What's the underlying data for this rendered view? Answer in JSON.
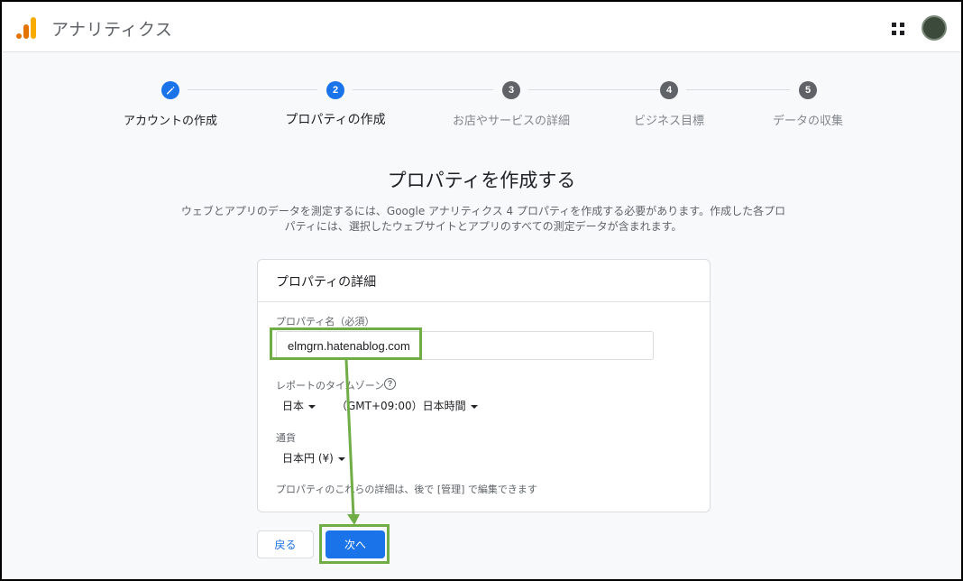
{
  "header": {
    "app_title": "アナリティクス",
    "logo_icon": "analytics-logo-icon",
    "apps_icon": "apps-grid-icon",
    "accent_color": "#f9ab00"
  },
  "stepper": {
    "steps": [
      {
        "label": "アカウントの作成",
        "marker": "",
        "state": "done",
        "icon": "pencil-icon"
      },
      {
        "label": "プロパティの作成",
        "marker": "2",
        "state": "current"
      },
      {
        "label": "お店やサービスの詳細",
        "marker": "3",
        "state": "future"
      },
      {
        "label": "ビジネス目標",
        "marker": "4",
        "state": "future"
      },
      {
        "label": "データの収集",
        "marker": "5",
        "state": "future"
      }
    ],
    "active_color": "#1a73e8",
    "future_color": "#5f6368"
  },
  "main": {
    "title": "プロパティを作成する",
    "description": "ウェブとアプリのデータを測定するには、Google アナリティクス 4 プロパティを作成する必要があります。作成した各プロパティには、選択したウェブサイトとアプリのすべての測定データが含まれます。"
  },
  "card": {
    "title": "プロパティの詳細",
    "property_name_label": "プロパティ名（必須）",
    "property_name_value": "elmgrn.hatenablog.com",
    "timezone_label": "レポートのタイムゾーン",
    "timezone_country": "日本",
    "timezone_value": "（GMT+09:00）日本時間",
    "currency_label": "通貨",
    "currency_value": "日本円 (¥)",
    "note": "プロパティのこれらの詳細は、後で [管理] で編集できます"
  },
  "buttons": {
    "back": "戻る",
    "next": "次へ"
  },
  "annotation": {
    "highlight_color": "#70ad47"
  }
}
